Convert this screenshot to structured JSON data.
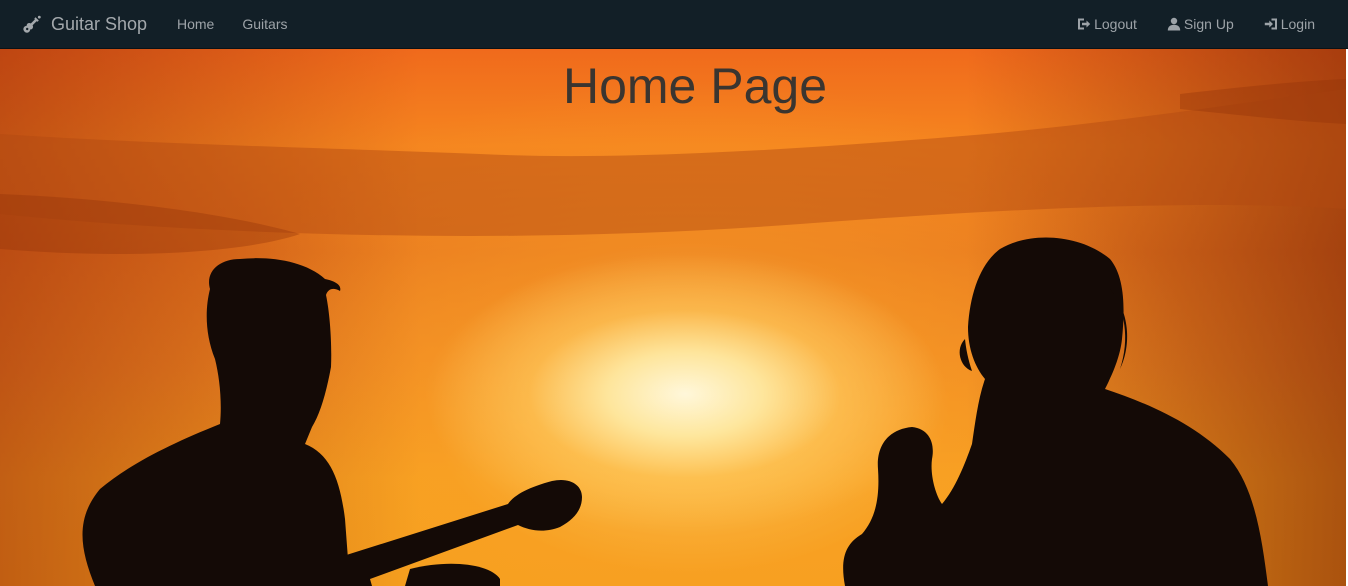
{
  "navbar": {
    "brand": {
      "label": "Guitar Shop",
      "icon": "guitar-icon"
    },
    "left_links": [
      {
        "label": "Home"
      },
      {
        "label": "Guitars"
      }
    ],
    "right_links": [
      {
        "label": "Logout",
        "icon": "logout-icon"
      },
      {
        "label": "Sign Up",
        "icon": "user-icon"
      },
      {
        "label": "Login",
        "icon": "login-icon"
      }
    ]
  },
  "hero": {
    "title": "Home Page"
  },
  "colors": {
    "navbar_bg": "#121f27",
    "nav_text": "#9da3a8",
    "sky_orange": "#f5851f",
    "silhouette": "#140a06",
    "title_text": "#3a3530"
  }
}
